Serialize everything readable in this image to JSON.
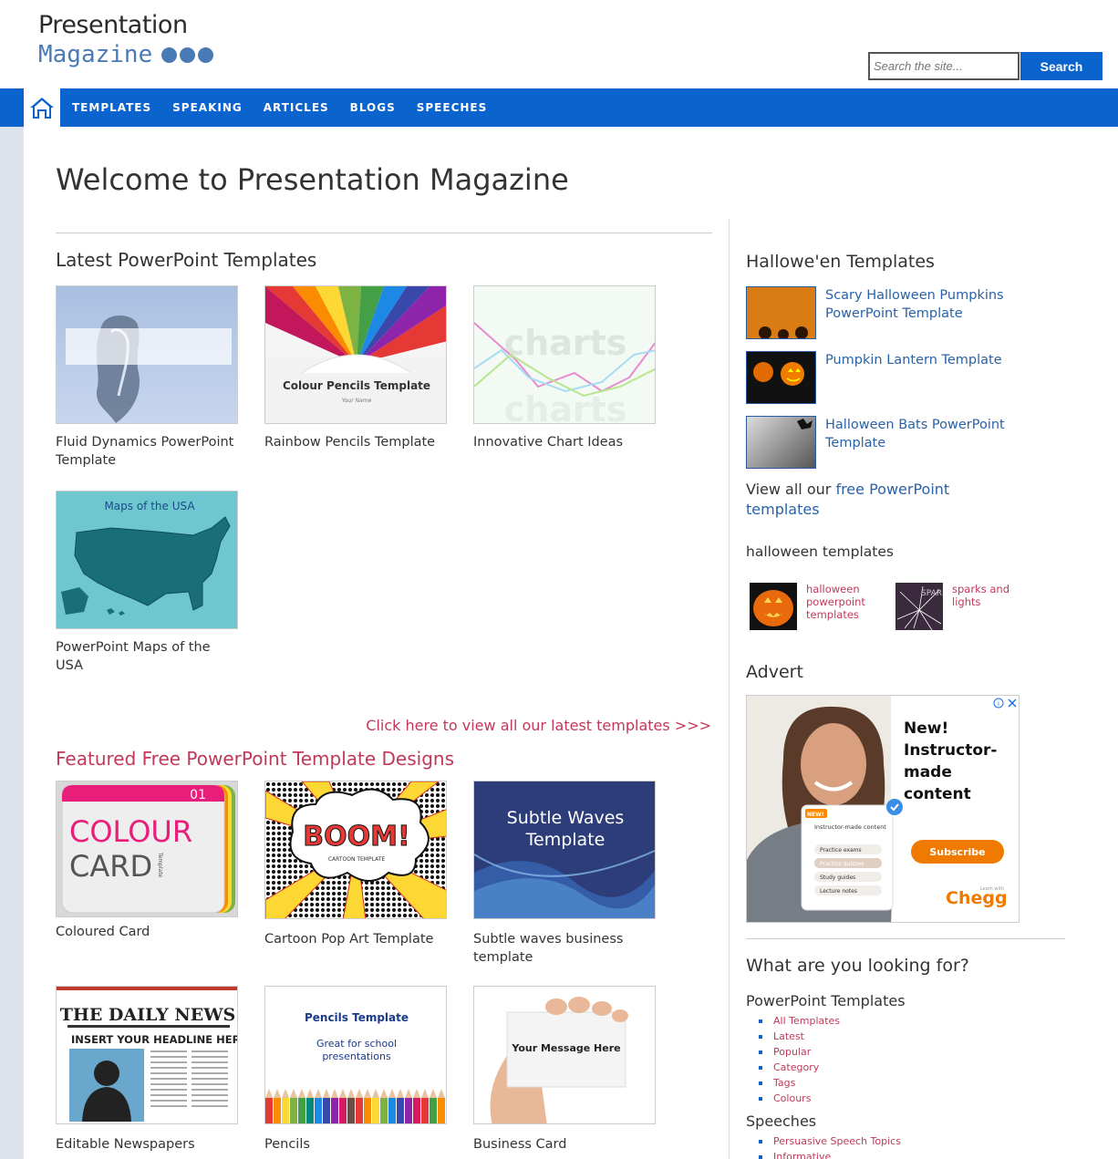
{
  "logo": {
    "line1": "Presentation",
    "line2": "Magazine"
  },
  "search": {
    "placeholder": "Search the site...",
    "button": "Search"
  },
  "nav": {
    "items": [
      "TEMPLATES",
      "SPEAKING",
      "ARTICLES",
      "BLOGS",
      "SPEECHES"
    ]
  },
  "main": {
    "title": "Welcome to Presentation Magazine",
    "latest_heading": "Latest PowerPoint Templates",
    "latest": [
      {
        "caption": "Fluid Dynamics PowerPoint Template"
      },
      {
        "caption": "Rainbow Pencils Template",
        "thumb_title": "Colour Pencils Template",
        "thumb_sub": "Your Name"
      },
      {
        "caption": "Innovative Chart Ideas",
        "thumb_word": "charts"
      },
      {
        "caption": "PowerPoint Maps of the USA",
        "thumb_title": "Maps of the USA"
      }
    ],
    "view_all": "Click here to view all our latest templates >>>",
    "featured_heading": "Featured Free PowerPoint Template Designs",
    "featured": [
      {
        "caption": "Coloured Card",
        "thumb_num": "01",
        "thumb_w1": "COLOUR",
        "thumb_w2": "CARD",
        "thumb_side": "Template"
      },
      {
        "caption": "Cartoon Pop Art Template",
        "thumb_word": "BOOM!",
        "thumb_sub": "CARTOON TEMPLATE"
      },
      {
        "caption": "Subtle waves business template",
        "thumb_title": "Subtle Waves Template"
      },
      {
        "caption": "Editable Newspapers",
        "thumb_title": "THE DAILY NEWS",
        "thumb_sub": "INSERT YOUR HEADLINE HERE"
      },
      {
        "caption": "Pencils",
        "thumb_title": "Pencils Template",
        "thumb_sub": "Great for school presentations"
      },
      {
        "caption": "Business Card",
        "thumb_title": "Your Message Here"
      }
    ]
  },
  "sidebar": {
    "halloween_heading": "Hallowe'en Templates",
    "halloween_items": [
      {
        "label": "Scary Halloween Pumpkins PowerPoint Template"
      },
      {
        "label": "Pumpkin Lantern Template"
      },
      {
        "label": "Halloween Bats PowerPoint Template"
      }
    ],
    "view_all_prefix": "View all our ",
    "view_all_link": "free PowerPoint templates",
    "halloween_templates_heading": "halloween templates",
    "small_items": [
      {
        "label": "halloween powerpoint templates"
      },
      {
        "label": "sparks and lights"
      }
    ],
    "advert_heading": "Advert",
    "ad": {
      "headline": "New! Instructor-made content",
      "button": "Subscribe",
      "brand": "Chegg",
      "learn": "Learn with",
      "card_badge": "NEW!",
      "card_title": "Instructor-made content",
      "card_items": [
        "Practice exams",
        "Practice quizzes",
        "Study guides",
        "Lecture notes"
      ]
    },
    "looking_heading": "What are you looking for?",
    "templates_heading": "PowerPoint Templates",
    "templates_links": [
      "All Templates",
      "Latest",
      "Popular",
      "Category",
      "Tags",
      "Colours"
    ],
    "speeches_heading": "Speeches",
    "speeches_links": [
      "Persuasive Speech Topics",
      "Informative"
    ]
  },
  "colors": {
    "brand_blue": "#0b63ce",
    "link_blue": "#2a62a8",
    "accent_pink": "#c0395a"
  }
}
